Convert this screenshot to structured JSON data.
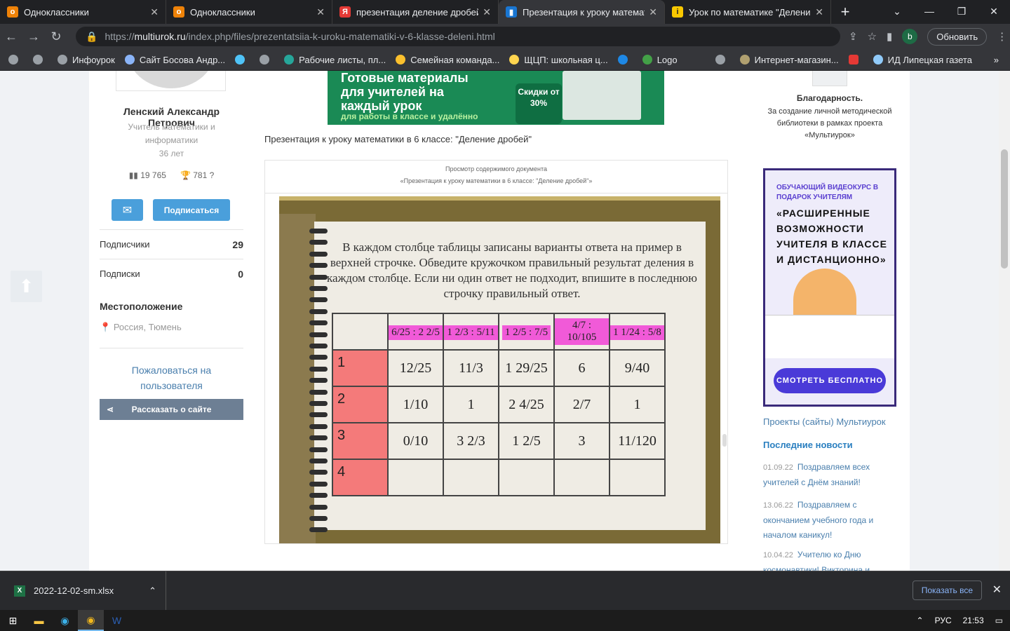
{
  "tabs": [
    {
      "title": "Одноклассники",
      "color": "#ee8208",
      "glyph": "о"
    },
    {
      "title": "Одноклассники",
      "color": "#ee8208",
      "glyph": "о"
    },
    {
      "title": "презентация деление дробей 6",
      "color": "#e53935",
      "glyph": "Я"
    },
    {
      "title": "Презентация к уроку математи",
      "color": "#1976d2",
      "glyph": "▮"
    },
    {
      "title": "Урок по математике \"Деление",
      "color": "#f9c800",
      "glyph": "i"
    }
  ],
  "address": {
    "scheme": "https://",
    "host": "multiurok.ru",
    "path": "/index.php/files/prezentatsiia-k-uroku-matematiki-v-6-klasse-deleni.html",
    "update": "Обновить",
    "avatar": "b"
  },
  "bookmarks": [
    "",
    "",
    "Инфоурок",
    "Сайт Босова Андр...",
    "",
    "",
    "Рабочие листы, пл...",
    "Семейная команда...",
    "ЩЦП: школьная ц...",
    "",
    "Logo",
    "",
    "Интернет-магазин...",
    "",
    "ИД Липецкая газета"
  ],
  "profile": {
    "name": "Ленский Александр Петрович",
    "role": "Учитель математики и информатики",
    "age": "36 лет",
    "views": "19 765",
    "awards": "781",
    "subscribe": "Подписаться",
    "subscribers_label": "Подписчики",
    "subscribers": "29",
    "subs_label": "Подписки",
    "subs": "0",
    "loc_label": "Местоположение",
    "loc": "Россия, Тюмень",
    "complain": "Пожаловаться на пользователя",
    "share": "Рассказать о сайте"
  },
  "banner": {
    "title": "Готовые материалы для учителей на каждый урок",
    "sub": "для работы в классе и удалённо",
    "disc": "Скидки от 30%"
  },
  "doc": {
    "title": "Презентация к уроку математики в 6 классе: \"Деление дробей\"",
    "vh1": "Просмотр содержимого документа",
    "vh2": "«Презентация к уроку математики в 6 классе: \"Деление дробей\"»"
  },
  "slide": {
    "text": "В каждом столбце таблицы записаны варианты ответа на пример в верхней строчке. Обведите кружочком правильный результат деления в каждом столбце. Если ни один ответ не подходит, впишите в последнюю строчку правильный ответ.",
    "headers": [
      "6/25 : 2 2/5",
      "1 2/3 : 5/11",
      "1 2/5 : 7/5",
      "4/7 : 10/105",
      "1 1/24 : 5/8"
    ],
    "rows": [
      {
        "label": "1",
        "cells": [
          "12/25",
          "11/3",
          "1 29/25",
          "6",
          "9/40"
        ]
      },
      {
        "label": "2",
        "cells": [
          "1/10",
          "1",
          "2 4/25",
          "2/7",
          "1"
        ]
      },
      {
        "label": "3",
        "cells": [
          "0/10",
          "3 2/3",
          "1 2/5",
          "3",
          "11/120"
        ]
      },
      {
        "label": "4",
        "cells": [
          "",
          "",
          "",
          "",
          ""
        ]
      }
    ]
  },
  "right": {
    "thanks": "Благодарность.",
    "thanks_text": "За создание личной методической библиотеки в рамках проекта «Мультиурок»",
    "vid_t1": "ОБУЧАЮЩИЙ ВИДЕОКУРС В ПОДАРОК УЧИТЕЛЯМ",
    "vid_t2": "«РАСШИРЕННЫЕ ВОЗМОЖНОСТИ УЧИТЕЛЯ В КЛАССЕ И ДИСТАНЦИОННО»",
    "vid_cta": "СМОТРЕТЬ БЕСПЛАТНО",
    "projects": "Проекты (сайты) Мультиурок",
    "news_h": "Последние новости",
    "news": [
      {
        "date": "01.09.22",
        "text": "Поздравляем всех учителей с Днём знаний!"
      },
      {
        "date": "13.06.22",
        "text": "Поздравляем с окончанием учебного года и началом каникул!"
      },
      {
        "date": "10.04.22",
        "text": "Учителю ко Дню космонавтики! Викторина и"
      }
    ]
  },
  "download": {
    "file": "2022-12-02-sm.xlsx",
    "showall": "Показать все"
  },
  "taskbar": {
    "lang": "РУС",
    "time": "21:53"
  }
}
